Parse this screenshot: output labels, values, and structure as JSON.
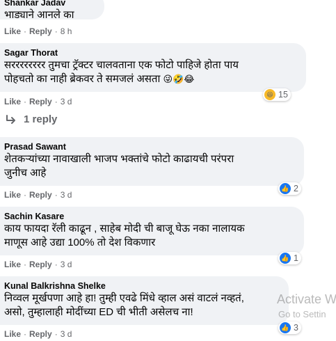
{
  "comments": [
    {
      "name": "Shankar Jadav",
      "text": "भाड्याने आनले का",
      "like": "Like",
      "reply": "Reply",
      "time": "8 h"
    },
    {
      "name": "Sagar Thorat",
      "text_line1": "सरररररररर तुमचा ट्रॅक्टर चालवताना एक फोटो पाहिजे होता पाय",
      "text_line2": "पोहचतो का नाही ब्रेकवर ते समजलं असता",
      "emojis": "😜🤣😂",
      "like": "Like",
      "reply": "Reply",
      "time": "3 d",
      "reaction_count": "15"
    },
    {
      "name": "Prasad Sawant",
      "text_line1": "शेतकऱ्यांच्या नावाखाली भाजप भक्तांचे फोटो काढायची परंपरा",
      "text_line2": "जुनीच आहे",
      "like": "Like",
      "reply": "Reply",
      "time": "3 d",
      "reaction_count": "2"
    },
    {
      "name": "Sachin Kasare",
      "text_line1": "काय फायदा रॅली काढून , साहेब मोदी ची बाजू घेऊ नका नालायक",
      "text_line2": "माणूस आहे उद्या 100% तो देश विकणार",
      "like": "Like",
      "reply": "Reply",
      "time": "3 d",
      "reaction_count": "1"
    },
    {
      "name": "Kunal Balkrishna Shelke",
      "text_line1": "निव्वल मूर्खपणा आहे हा! तुम्ही एवढे मिंधे व्हाल असं वाटलं नव्हतं,",
      "text_line2": "असो, तुम्हालाही मोदींच्या ED ची भीती असेलच ना!",
      "like": "Like",
      "reply": "Reply",
      "time": "3 d",
      "reaction_count": "3"
    }
  ],
  "replies_link": "1 reply",
  "dot": "·",
  "watermark": {
    "line1": "Activate W",
    "line2": "Go to Settin"
  }
}
